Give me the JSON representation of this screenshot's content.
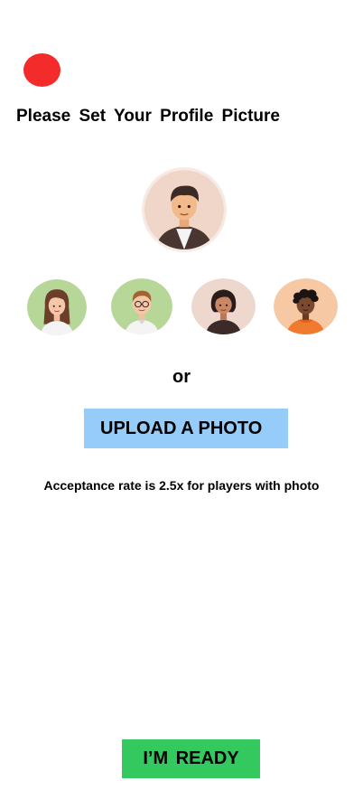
{
  "header": {
    "close_icon": "red-circle-icon",
    "close_color": "#f42b2b",
    "title": "Please Set Your Profile Picture"
  },
  "selected_avatar": {
    "icon": "man-avatar-icon"
  },
  "avatar_options": [
    {
      "icon": "woman-avatar-icon",
      "bg": "#b6d798"
    },
    {
      "icon": "man-glasses-avatar-icon",
      "bg": "#b6d798"
    },
    {
      "icon": "woman-short-hair-avatar-icon",
      "bg": "#eed7cc"
    },
    {
      "icon": "man-curly-hair-avatar-icon",
      "bg": "#f6c8a3"
    }
  ],
  "divider_text": "or",
  "upload": {
    "label": "UPLOAD A PHOTO",
    "color": "#95ccf9"
  },
  "note": "Acceptance rate is 2.5x for players with photo",
  "ready": {
    "label": "I’M READY",
    "color": "#33c95e"
  }
}
